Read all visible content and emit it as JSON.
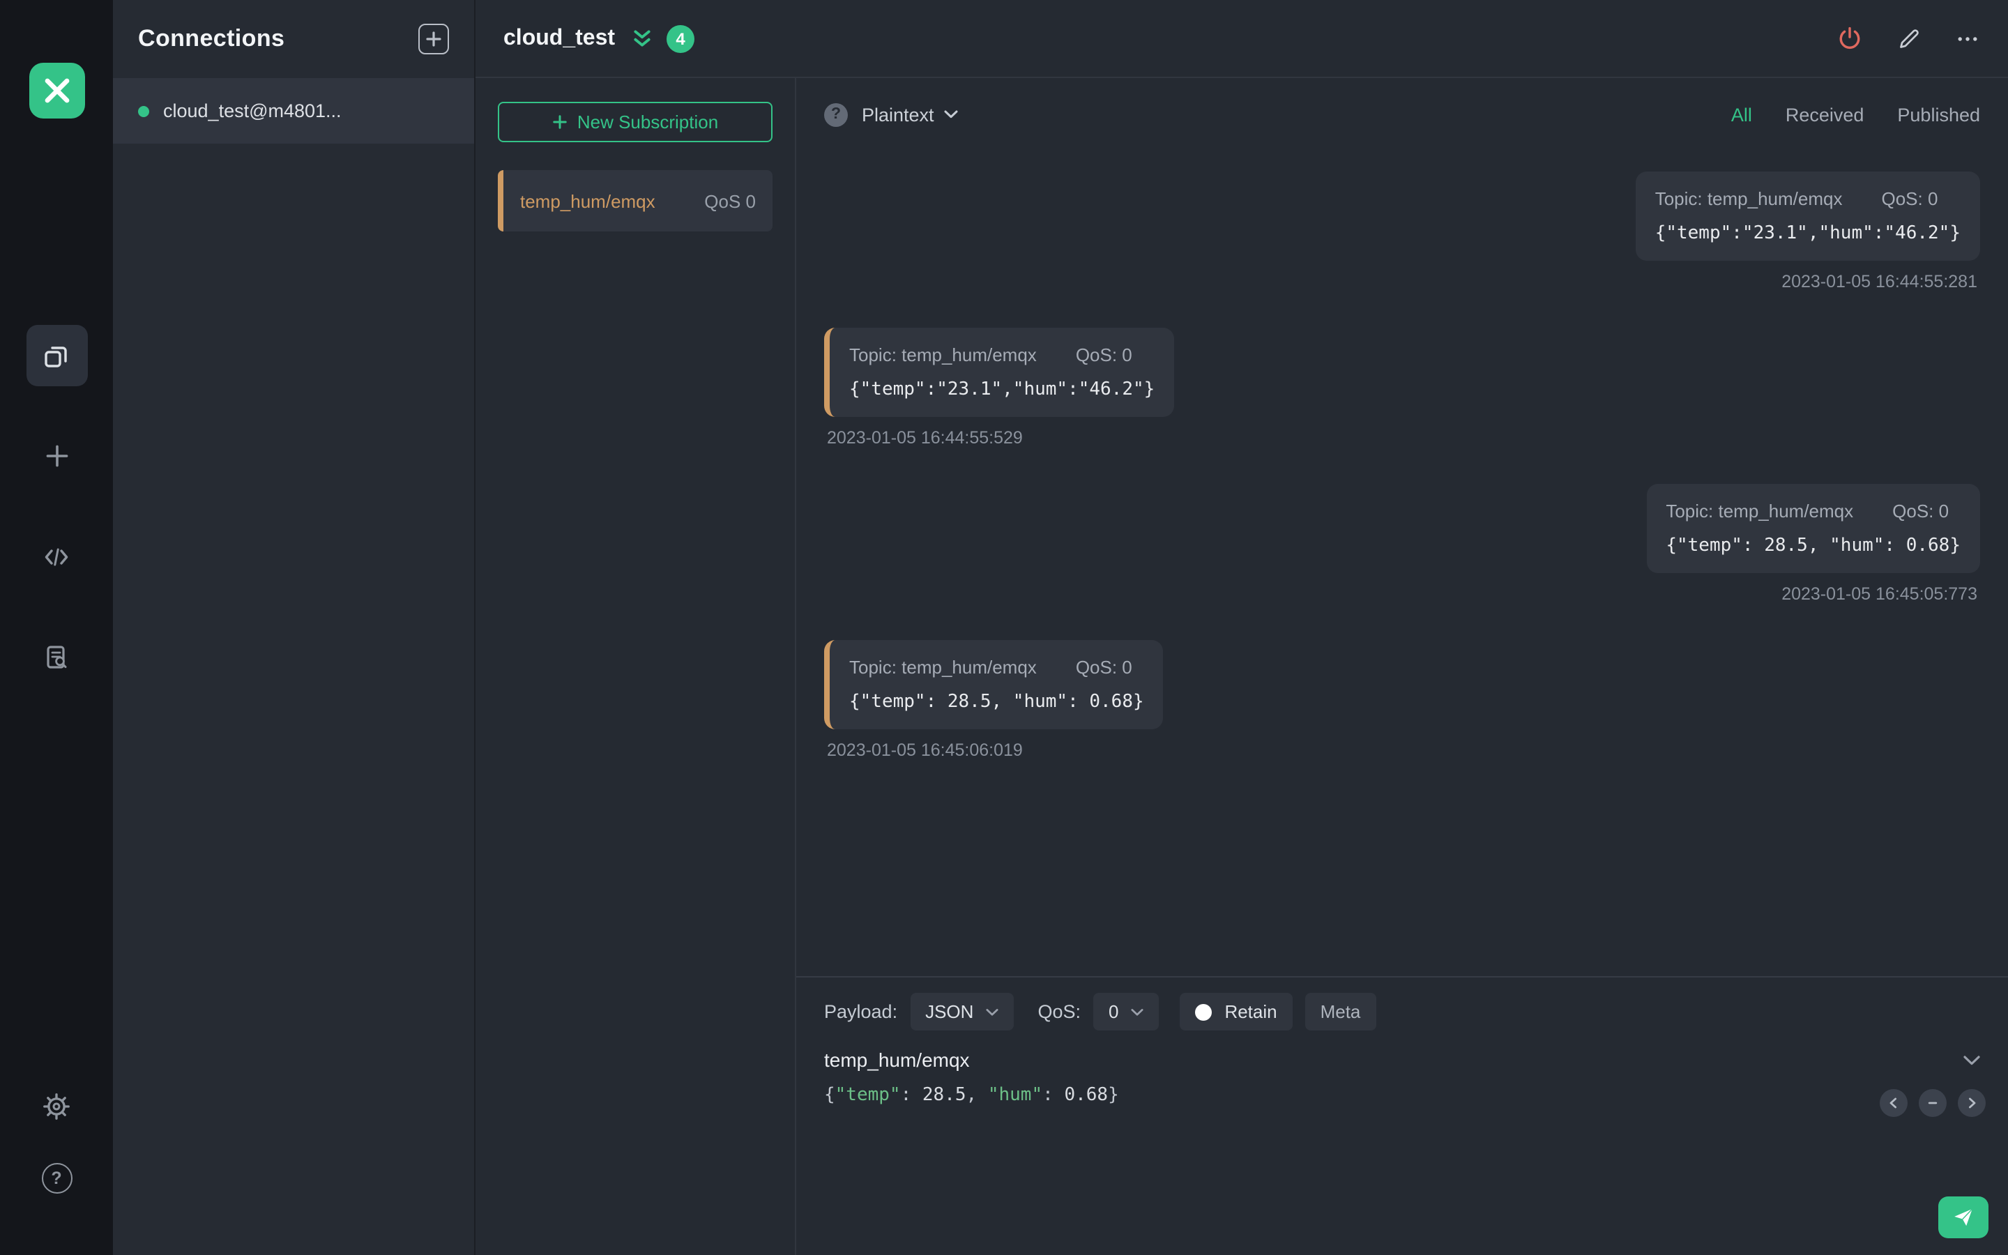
{
  "colors": {
    "accent_green": "#34c388",
    "topic_orange": "#cf9b63",
    "disconnect_red": "#e0695f",
    "panel_bg": "#262b33",
    "bubble_bg": "#30353e"
  },
  "sidebar": {
    "logo_icon": "mqttx-logo",
    "items": [
      {
        "name": "connections",
        "icon": "connections-icon",
        "active": true
      },
      {
        "name": "new-connection",
        "icon": "plus-icon",
        "active": false
      },
      {
        "name": "script",
        "icon": "code-icon",
        "active": false
      },
      {
        "name": "log",
        "icon": "log-icon",
        "active": false
      }
    ],
    "bottom_items": [
      {
        "name": "settings",
        "icon": "gear-icon"
      },
      {
        "name": "help",
        "icon": "question-icon",
        "glyph": "?"
      }
    ]
  },
  "connections": {
    "title": "Connections",
    "items": [
      {
        "name": "cloud_test@m4801...",
        "connected": true
      }
    ]
  },
  "topbar": {
    "title": "cloud_test",
    "badge_count": "4"
  },
  "subscriptions": {
    "new_button_label": "New Subscription",
    "items": [
      {
        "topic": "temp_hum/emqx",
        "qos_label": "QoS 0"
      }
    ]
  },
  "message_toolbar": {
    "format_label": "Plaintext",
    "filters": [
      {
        "label": "All",
        "active": true
      },
      {
        "label": "Received",
        "active": false
      },
      {
        "label": "Published",
        "active": false
      }
    ]
  },
  "messages": [
    {
      "type": "published",
      "topic_label": "Topic: temp_hum/emqx",
      "qos_label": "QoS: 0",
      "payload": "{\"temp\":\"23.1\",\"hum\":\"46.2\"}",
      "timestamp": "2023-01-05 16:44:55:281"
    },
    {
      "type": "received",
      "topic_label": "Topic: temp_hum/emqx",
      "qos_label": "QoS: 0",
      "payload": "{\"temp\":\"23.1\",\"hum\":\"46.2\"}",
      "timestamp": "2023-01-05 16:44:55:529"
    },
    {
      "type": "published",
      "topic_label": "Topic: temp_hum/emqx",
      "qos_label": "QoS: 0",
      "payload": "{\"temp\": 28.5, \"hum\": 0.68}",
      "timestamp": "2023-01-05 16:45:05:773"
    },
    {
      "type": "received",
      "topic_label": "Topic: temp_hum/emqx",
      "qos_label": "QoS: 0",
      "payload": "{\"temp\": 28.5, \"hum\": 0.68}",
      "timestamp": "2023-01-05 16:45:06:019"
    }
  ],
  "publish": {
    "payload_label": "Payload:",
    "payload_format": "JSON",
    "qos_label": "QoS:",
    "qos_value": "0",
    "retain_label": "Retain",
    "meta_label": "Meta",
    "topic_value": "temp_hum/emqx",
    "payload_value": "{\"temp\": 28.5, \"hum\": 0.68}",
    "payload_tokens": [
      {
        "text": "{",
        "type": "punct"
      },
      {
        "text": "\"temp\"",
        "type": "key"
      },
      {
        "text": ": ",
        "type": "punct"
      },
      {
        "text": "28.5",
        "type": "number"
      },
      {
        "text": ", ",
        "type": "punct"
      },
      {
        "text": "\"hum\"",
        "type": "key"
      },
      {
        "text": ": ",
        "type": "punct"
      },
      {
        "text": "0.68",
        "type": "number"
      },
      {
        "text": "}",
        "type": "punct"
      }
    ]
  }
}
